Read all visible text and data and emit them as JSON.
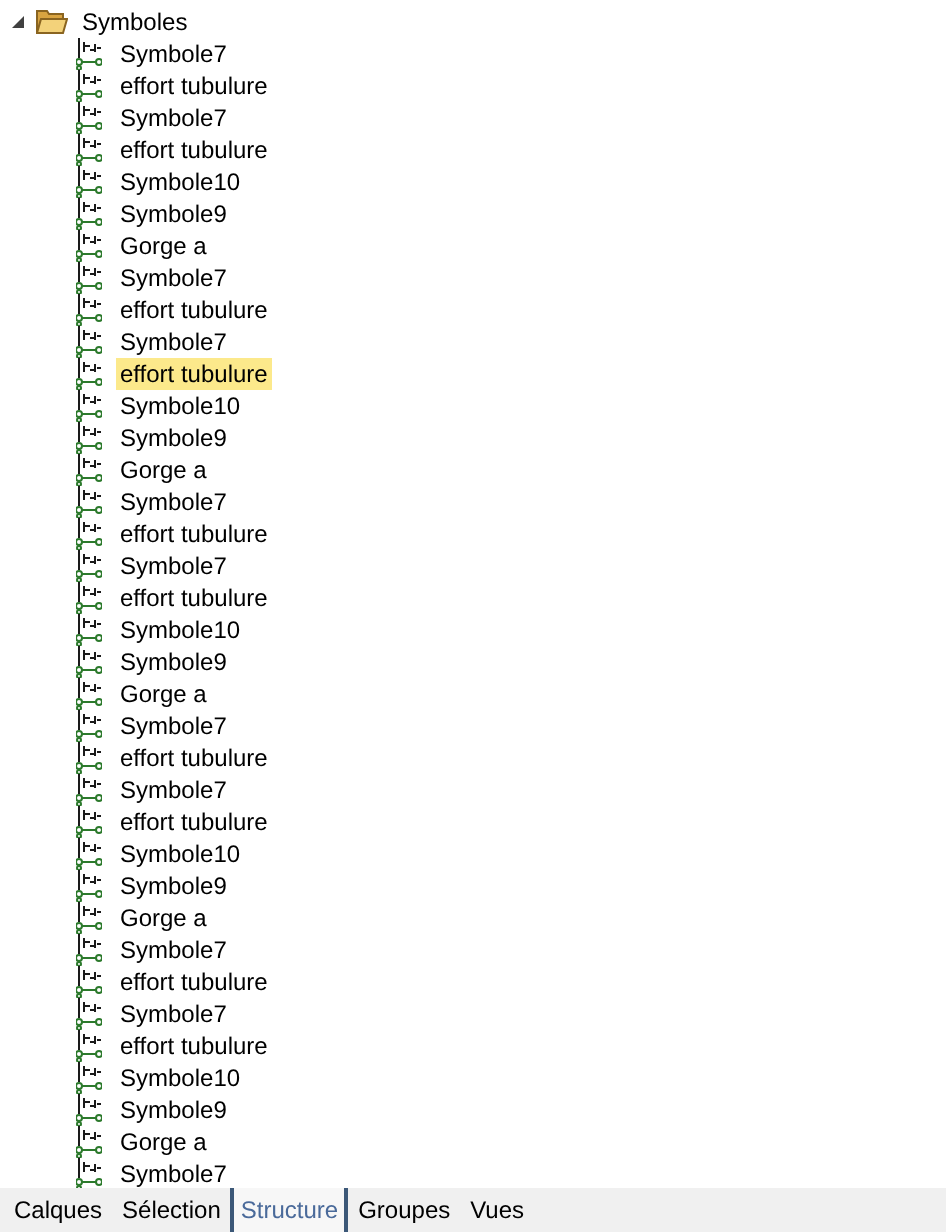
{
  "tree": {
    "label": "Symboles",
    "expanded": true,
    "children": [
      {
        "label": "Symbole7",
        "selected": false
      },
      {
        "label": "effort tubulure",
        "selected": false
      },
      {
        "label": "Symbole7",
        "selected": false
      },
      {
        "label": "effort tubulure",
        "selected": false
      },
      {
        "label": "Symbole10",
        "selected": false
      },
      {
        "label": "Symbole9",
        "selected": false
      },
      {
        "label": "Gorge a",
        "selected": false
      },
      {
        "label": "Symbole7",
        "selected": false
      },
      {
        "label": "effort tubulure",
        "selected": false
      },
      {
        "label": "Symbole7",
        "selected": false
      },
      {
        "label": "effort tubulure",
        "selected": true
      },
      {
        "label": "Symbole10",
        "selected": false
      },
      {
        "label": "Symbole9",
        "selected": false
      },
      {
        "label": "Gorge a",
        "selected": false
      },
      {
        "label": "Symbole7",
        "selected": false
      },
      {
        "label": "effort tubulure",
        "selected": false
      },
      {
        "label": "Symbole7",
        "selected": false
      },
      {
        "label": "effort tubulure",
        "selected": false
      },
      {
        "label": "Symbole10",
        "selected": false
      },
      {
        "label": "Symbole9",
        "selected": false
      },
      {
        "label": "Gorge a",
        "selected": false
      },
      {
        "label": "Symbole7",
        "selected": false
      },
      {
        "label": "effort tubulure",
        "selected": false
      },
      {
        "label": "Symbole7",
        "selected": false
      },
      {
        "label": "effort tubulure",
        "selected": false
      },
      {
        "label": "Symbole10",
        "selected": false
      },
      {
        "label": "Symbole9",
        "selected": false
      },
      {
        "label": "Gorge a",
        "selected": false
      },
      {
        "label": "Symbole7",
        "selected": false
      },
      {
        "label": "effort tubulure",
        "selected": false
      },
      {
        "label": "Symbole7",
        "selected": false
      },
      {
        "label": "effort tubulure",
        "selected": false
      },
      {
        "label": "Symbole10",
        "selected": false
      },
      {
        "label": "Symbole9",
        "selected": false
      },
      {
        "label": "Gorge a",
        "selected": false
      },
      {
        "label": "Symbole7",
        "selected": false
      }
    ]
  },
  "tabs": [
    {
      "label": "Calques",
      "selected": false
    },
    {
      "label": "Sélection",
      "selected": false
    },
    {
      "label": "Structure",
      "selected": true
    },
    {
      "label": "Groupes",
      "selected": false
    },
    {
      "label": "Vues",
      "selected": false
    }
  ]
}
